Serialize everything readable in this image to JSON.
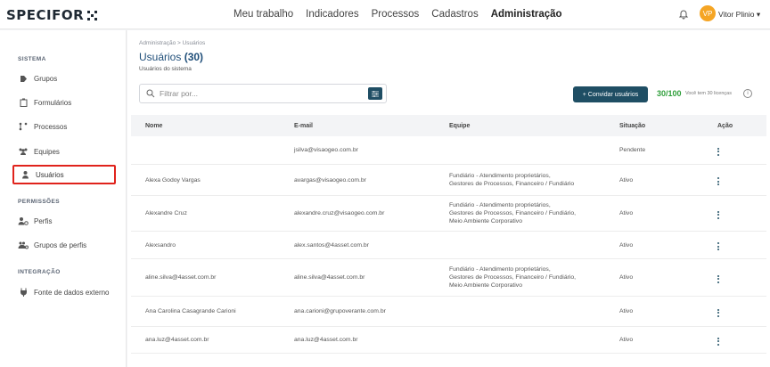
{
  "app": {
    "logo": "SPECIFOR"
  },
  "nav": {
    "items": [
      {
        "label": "Meu trabalho"
      },
      {
        "label": "Indicadores"
      },
      {
        "label": "Processos"
      },
      {
        "label": "Cadastros"
      },
      {
        "label": "Administração",
        "active": true
      }
    ]
  },
  "user": {
    "initials": "VP",
    "name": "Vitor Plinio",
    "chevron": "▾"
  },
  "sidebar": {
    "sections": [
      {
        "title": "SISTEMA"
      },
      {
        "title": "PERMISSÕES"
      },
      {
        "title": "INTEGRAÇÃO"
      }
    ],
    "items": [
      {
        "label": "Grupos",
        "icon": "tag-icon"
      },
      {
        "label": "Formulários",
        "icon": "clipboard-icon"
      },
      {
        "label": "Processos",
        "icon": "flow-icon"
      },
      {
        "label": "Equipes",
        "icon": "team-icon"
      },
      {
        "label": "Usuários",
        "icon": "user-icon",
        "selected": true
      },
      {
        "label": "Perfis",
        "icon": "profile-icon"
      },
      {
        "label": "Grupos de perfis",
        "icon": "profile-group-icon"
      },
      {
        "label": "Fonte de dados externo",
        "icon": "plug-icon"
      }
    ]
  },
  "page": {
    "breadcrumb": "Administração  >  Usuários",
    "title": "Usuários",
    "count": "(30)",
    "subtitle": "Usuários do sistema"
  },
  "search": {
    "placeholder": "Filtrar por..."
  },
  "actions": {
    "invite_label": "+ Convidar usuários",
    "quota": "30/100",
    "quota_note": "Você tem 30 licenças"
  },
  "table": {
    "headers": {
      "name": "Nome",
      "email": "E-mail",
      "team": "Equipe",
      "status": "Situação",
      "action": "Ação"
    },
    "rows": [
      {
        "name": "",
        "email": "jsilva@visaogeo.com.br",
        "team": [],
        "status": "Pendente"
      },
      {
        "name": "Alexa Godoy Vargas",
        "email": "avargas@visaogeo.com.br",
        "team": [
          "Fundiário - Atendimento proprietários,",
          "Gestores de Processos, Financeiro / Fundiário"
        ],
        "status": "Ativo"
      },
      {
        "name": "Alexandre Cruz",
        "email": "alexandre.cruz@visaogeo.com.br",
        "team": [
          "Fundiário - Atendimento proprietários,",
          "Gestores de Processos, Financeiro / Fundiário,",
          "Meio Ambiente Corporativo"
        ],
        "status": "Ativo"
      },
      {
        "name": "Alexsandro",
        "email": "alex.santos@4asset.com.br",
        "team": [],
        "status": "Ativo"
      },
      {
        "name": "aline.silva@4asset.com.br",
        "email": "aline.silva@4asset.com.br",
        "team": [
          "Fundiário - Atendimento proprietários,",
          "Gestores de Processos, Financeiro / Fundiário,",
          "Meio Ambiente Corporativo"
        ],
        "status": "Ativo"
      },
      {
        "name": "Ana Carolina Casagrande Carioni",
        "email": "ana.carioni@grupoverante.com.br",
        "team": [],
        "status": "Ativo"
      },
      {
        "name": "ana.luz@4asset.com.br",
        "email": "ana.luz@4asset.com.br",
        "team": [],
        "status": "Ativo"
      }
    ]
  },
  "colors": {
    "primary": "#1f4e64",
    "title_blue": "#1f4e79",
    "quota_green": "#2e9e3a",
    "highlight_red": "#e0231c",
    "avatar_orange": "#f5a524"
  }
}
